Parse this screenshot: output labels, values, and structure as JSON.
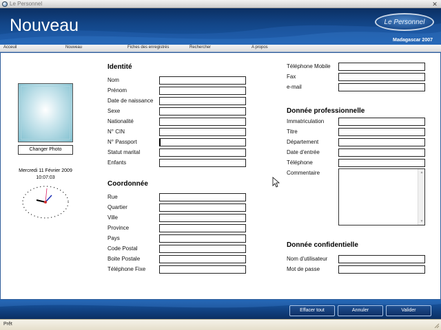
{
  "window": {
    "title": "Le Personnel"
  },
  "header": {
    "page_title": "Nouveau",
    "logo_text": "Le Personnel",
    "location": "Madagascar 2007"
  },
  "menu": [
    {
      "label": "Acceuil"
    },
    {
      "label": "Nouveau"
    },
    {
      "label": "Fiches des enregistrés"
    },
    {
      "label": "Rechercher"
    },
    {
      "label": "A propos"
    }
  ],
  "left_panel": {
    "change_photo_label": "Changer Photo",
    "date": "Mercredi 11 Février 2009",
    "time": "10:07:03"
  },
  "identite": {
    "title": "Identité",
    "fields": [
      {
        "label": "Nom",
        "value": ""
      },
      {
        "label": "Prénom",
        "value": ""
      },
      {
        "label": "Date de naissance",
        "value": ""
      },
      {
        "label": "Sexe",
        "value": ""
      },
      {
        "label": "Nationalité",
        "value": ""
      },
      {
        "label": "N° CIN",
        "value": ""
      },
      {
        "label": "N° Passport",
        "value": ""
      },
      {
        "label": "Statut marital",
        "value": ""
      },
      {
        "label": "Enfants",
        "value": ""
      }
    ]
  },
  "coordonnee": {
    "title": "Coordonnée",
    "fields": [
      {
        "label": "Rue",
        "value": ""
      },
      {
        "label": "Quartier",
        "value": ""
      },
      {
        "label": "Ville",
        "value": ""
      },
      {
        "label": "Province",
        "value": ""
      },
      {
        "label": "Pays",
        "value": ""
      },
      {
        "label": "Code Postal",
        "value": ""
      },
      {
        "label": "Boite Postale",
        "value": ""
      },
      {
        "label": "Téléphone Fixe",
        "value": ""
      }
    ]
  },
  "contact": {
    "fields": [
      {
        "label": "Téléphone Mobile",
        "value": ""
      },
      {
        "label": "Fax",
        "value": ""
      },
      {
        "label": "e-mail",
        "value": ""
      }
    ]
  },
  "pro": {
    "title": "Donnée professionnelle",
    "fields": [
      {
        "label": "Immatriculation",
        "value": ""
      },
      {
        "label": "Titre",
        "value": ""
      },
      {
        "label": "Département",
        "value": ""
      },
      {
        "label": "Date d'entrée",
        "value": ""
      },
      {
        "label": "Téléphone",
        "value": ""
      }
    ],
    "comment_label": "Commentaire",
    "comment_value": ""
  },
  "confidential": {
    "title": "Donnée confidentielle",
    "fields": [
      {
        "label": "Nom d'utilisateur",
        "value": ""
      },
      {
        "label": "Mot de passe",
        "value": ""
      }
    ]
  },
  "buttons": {
    "clear": "Effacer tout",
    "cancel": "Annuler",
    "validate": "Valider"
  },
  "status": {
    "text": "Prêt"
  },
  "colors": {
    "header_blue": "#124485",
    "button_blue": "#0f3066",
    "border_blue": "#2f5c99"
  }
}
